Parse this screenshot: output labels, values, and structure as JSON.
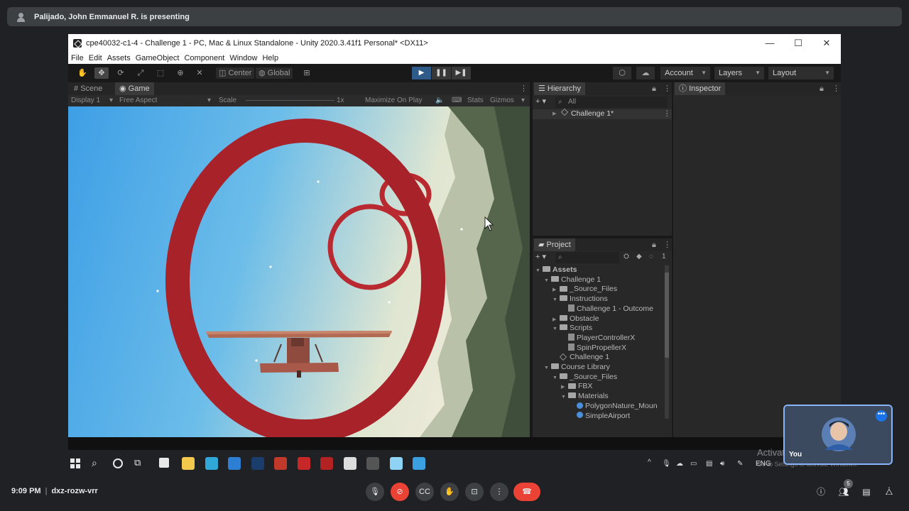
{
  "meet": {
    "presenter_text": "Palijado, John Emmanuel R. is presenting",
    "time": "9:09 PM",
    "meeting_code": "dxz-rozw-vrr",
    "self_label": "You",
    "participant_count": "5"
  },
  "window": {
    "title": "cpe40032-c1-4 - Challenge 1 - PC, Mac & Linux Standalone - Unity 2020.3.41f1 Personal* <DX11>",
    "minimize": "—",
    "maximize": "☐",
    "close": "✕"
  },
  "menu": [
    "File",
    "Edit",
    "Assets",
    "GameObject",
    "Component",
    "Window",
    "Help"
  ],
  "toolbar": {
    "pivot": "Center",
    "space": "Global",
    "account": "Account",
    "layers": "Layers",
    "layout": "Layout"
  },
  "scene_panel": {
    "tabs": [
      "Scene",
      "Game"
    ],
    "display": "Display 1",
    "aspect": "Free Aspect",
    "scale_label": "Scale",
    "scale_value": "1x",
    "maximize": "Maximize On Play",
    "stats": "Stats",
    "gizmos": "Gizmos"
  },
  "hierarchy": {
    "title": "Hierarchy",
    "search": "All",
    "root": "Challenge 1*"
  },
  "inspector": {
    "title": "Inspector"
  },
  "project": {
    "title": "Project",
    "count": "1",
    "items": [
      {
        "label": "Assets",
        "depth": 0,
        "type": "folder",
        "arrow": "▼"
      },
      {
        "label": "Challenge 1",
        "depth": 1,
        "type": "folder",
        "arrow": "▼"
      },
      {
        "label": "_Source_Files",
        "depth": 2,
        "type": "folder",
        "arrow": "▶"
      },
      {
        "label": "Instructions",
        "depth": 2,
        "type": "folder",
        "arrow": "▼"
      },
      {
        "label": "Challenge 1 - Outcome",
        "depth": 3,
        "type": "file",
        "arrow": ""
      },
      {
        "label": "Obstacle",
        "depth": 2,
        "type": "folder",
        "arrow": "▶"
      },
      {
        "label": "Scripts",
        "depth": 2,
        "type": "folder",
        "arrow": "▼"
      },
      {
        "label": "PlayerControllerX",
        "depth": 3,
        "type": "file",
        "arrow": ""
      },
      {
        "label": "SpinPropellerX",
        "depth": 3,
        "type": "file",
        "arrow": ""
      },
      {
        "label": "Challenge 1",
        "depth": 2,
        "type": "scene",
        "arrow": ""
      },
      {
        "label": "Course Library",
        "depth": 1,
        "type": "folder",
        "arrow": "▼"
      },
      {
        "label": "_Source_Files",
        "depth": 2,
        "type": "folder",
        "arrow": "▼"
      },
      {
        "label": "FBX",
        "depth": 3,
        "type": "folder",
        "arrow": "▶"
      },
      {
        "label": "Materials",
        "depth": 3,
        "type": "folder",
        "arrow": "▼"
      },
      {
        "label": "PolygonNature_Moun",
        "depth": 4,
        "type": "material",
        "arrow": ""
      },
      {
        "label": "SimpleAirport",
        "depth": 4,
        "type": "material",
        "arrow": ""
      }
    ]
  },
  "taskbar": {
    "lang": "ENG",
    "apps": [
      {
        "name": "file-explorer-icon",
        "color": "#f2c94c"
      },
      {
        "name": "edge-icon",
        "color": "#2fa8d8"
      },
      {
        "name": "mail-icon",
        "color": "#2d7fd3"
      },
      {
        "name": "steam-icon",
        "color": "#1b3d6b"
      },
      {
        "name": "app-red-icon",
        "color": "#c0392b"
      },
      {
        "name": "mcafee-icon",
        "color": "#c62828"
      },
      {
        "name": "vivaldi-icon",
        "color": "#b22222"
      },
      {
        "name": "unity-hub-icon",
        "color": "#dddddd"
      },
      {
        "name": "unity-editor-icon",
        "color": "#555555"
      },
      {
        "name": "notepad-icon",
        "color": "#8fd3f4"
      },
      {
        "name": "photos-icon",
        "color": "#3aa0e0"
      }
    ]
  },
  "watermark": {
    "title": "Activate Windows",
    "subtitle": "Go to Settings to activate Windows."
  }
}
